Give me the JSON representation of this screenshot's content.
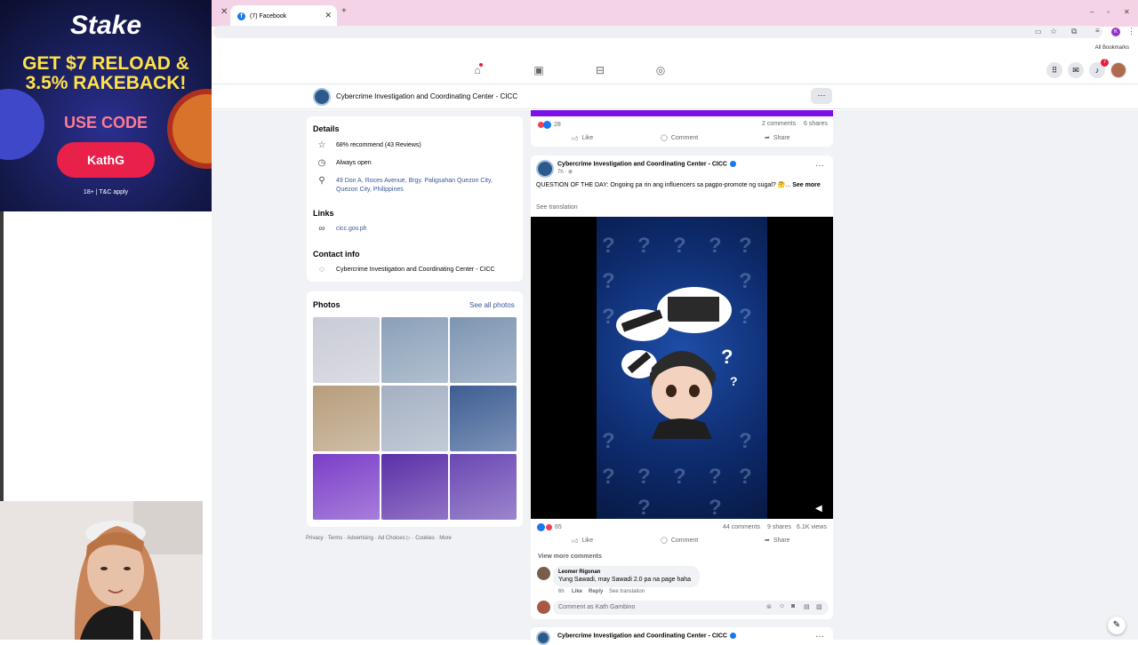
{
  "browser": {
    "tab_title": "(7) Facebook",
    "new_tab_symbol": "+",
    "bookmarks_label": "All Bookmarks"
  },
  "fb_nav": {
    "notification_count": "7",
    "icons": [
      "home-icon",
      "video-icon",
      "marketplace-icon",
      "groups-icon",
      "menu-grid-icon",
      "messenger-icon",
      "bell-icon"
    ]
  },
  "page": {
    "name": "Cybercrime Investigation and Coordinating Center - CICC",
    "more_symbol": "···"
  },
  "details": {
    "heading": "Details",
    "recommend": "68% recommend (43 Reviews)",
    "hours": "Always open",
    "address_line1": "49 Don A. Roces Avenue, Brgy. Paligsahan Quezon City,",
    "address_line2": "Quezon City, Philippines",
    "links_heading": "Links",
    "website": "cicc.gov.ph",
    "contact_heading": "Contact info",
    "contact_name": "Cybercrime Investigation and Coordinating Center - CICC"
  },
  "photos": {
    "heading": "Photos",
    "see_all": "See all photos",
    "tile_colors": [
      "#c9cbd6",
      "#8aa0b8",
      "#7d95b2",
      "#b79d7c",
      "#a4b0c2",
      "#3d5d93",
      "#7b3ec8",
      "#5b2fa8",
      "#6a48b3"
    ]
  },
  "footer": {
    "links": "Privacy · Terms · Advertising · Ad Choices ▷ · Cookies · More"
  },
  "post_a": {
    "reaction_count": "28",
    "comments": "2 comments",
    "shares": "6 shares",
    "like": "Like",
    "comment": "Comment",
    "share": "Share"
  },
  "post_b": {
    "author": "Cybercrime Investigation and Coordinating Center - CICC",
    "time": "7h · ⊕",
    "text": "QUESTION OF THE DAY: Ongoing pa rin ang influencers sa pagpo-promote ng sugal? 🤔...",
    "see_more": "See more",
    "see_translation": "See translation",
    "reaction_count": "65",
    "comments": "44 comments",
    "shares": "9 shares",
    "views": "6.1K views",
    "like": "Like",
    "comment": "Comment",
    "share": "Share",
    "view_more_comments": "View more comments",
    "commenter": "Leomer Rigonan",
    "comment_text": "Yung Sawadi, may Sawadi 2.0 pa na page haha",
    "comment_age": "6h",
    "comment_like": "Like",
    "comment_reply": "Reply",
    "comment_translation": "See translation",
    "comment_placeholder": "Comment as Kath Gambino"
  },
  "post_c": {
    "author": "Cybercrime Investigation and Coordinating Center - CICC"
  },
  "ad": {
    "brand": "Stake",
    "line1": "GET $7 RELOAD &",
    "line2": "3.5% RAKEBACK!",
    "line3": "USE CODE",
    "code": "KathG",
    "fine_print": "18+ | T&C apply"
  },
  "colors": {
    "fb_blue": "#1877f2",
    "tab_strip": "#f4d3e6",
    "post_banner": "#7c10e8",
    "ad_yellow": "#ffe24a",
    "ad_button": "#e8204a"
  }
}
